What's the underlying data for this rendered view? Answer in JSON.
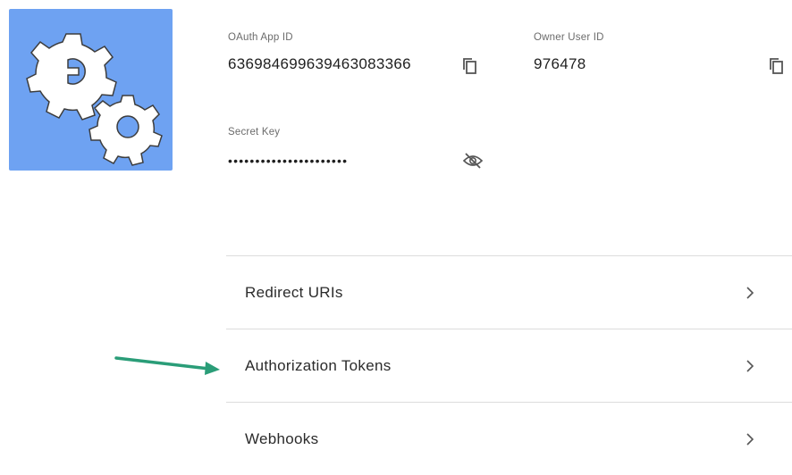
{
  "app": {
    "logo_icon": "gears-icon",
    "logo_color": "#6ea2f2"
  },
  "credentials": {
    "oauth_app_id": {
      "label": "OAuth App ID",
      "value": "636984699639463083366",
      "copy_icon": "copy-icon"
    },
    "owner_user_id": {
      "label": "Owner User ID",
      "value": "976478",
      "copy_icon": "copy-icon"
    },
    "secret_key": {
      "label": "Secret Key",
      "value": "••••••••••••••••••••••",
      "visibility_icon": "eye-off-icon"
    }
  },
  "menu": {
    "items": [
      {
        "label": "Redirect URIs",
        "icon": "chevron-right-icon"
      },
      {
        "label": "Authorization Tokens",
        "icon": "chevron-right-icon"
      },
      {
        "label": "Webhooks",
        "icon": "chevron-right-icon"
      }
    ]
  },
  "annotation": {
    "arrow_color": "#2a9d78",
    "points_to": "Authorization Tokens"
  }
}
